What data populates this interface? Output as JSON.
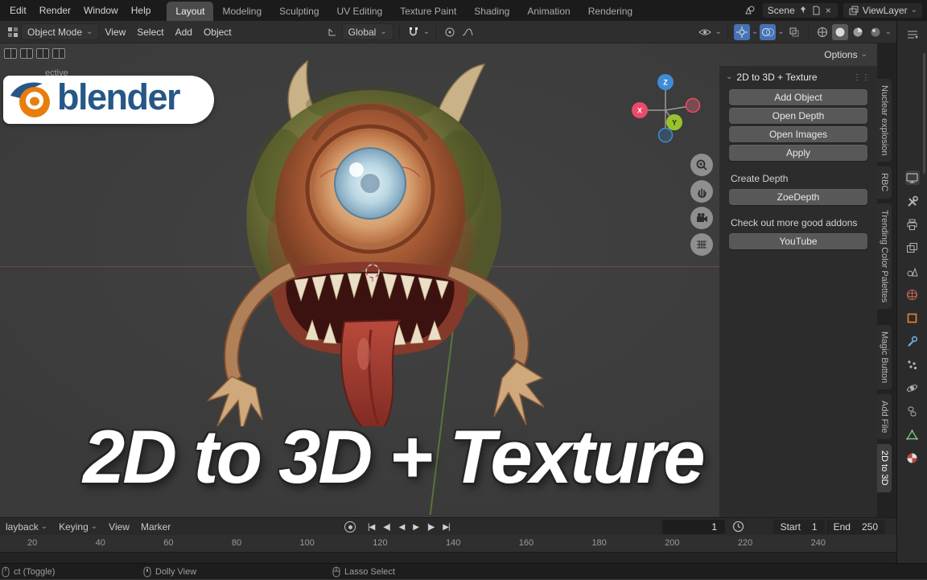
{
  "topbar": {
    "menus": [
      "Edit",
      "Render",
      "Window",
      "Help"
    ],
    "workspaces": [
      "Layout",
      "Modeling",
      "Sculpting",
      "UV Editing",
      "Texture Paint",
      "Shading",
      "Animation",
      "Rendering"
    ],
    "active_workspace": "Layout",
    "scene_label": "Scene",
    "viewlayer_label": "ViewLayer"
  },
  "toolbar": {
    "mode": "Object Mode",
    "menus": [
      "View",
      "Select",
      "Add",
      "Object"
    ],
    "orientation": "Global",
    "options_label": "Options"
  },
  "viewport": {
    "info": "ective",
    "logo_text": "blender",
    "caption": "2D to 3D + Texture",
    "gizmo": {
      "x": "X",
      "y": "Y",
      "z": "Z"
    }
  },
  "side_panel": {
    "title": "2D to 3D + Texture",
    "buttons": [
      "Add Object",
      "Open Depth",
      "Open Images",
      "Apply"
    ],
    "create_depth_label": "Create Depth",
    "zoedepth_button": "ZoeDepth",
    "addons_label": "Check out more good addons",
    "youtube_button": "YouTube"
  },
  "right_tabs": [
    "Nuclear explosion",
    "RBC",
    "Trending Color Palettes",
    "Magic Button",
    "Add File",
    "2D to 3D"
  ],
  "property_tab_icons": [
    "editor-type",
    "tool",
    "render",
    "output",
    "view-layer",
    "scene",
    "world",
    "object",
    "modifiers",
    "particles",
    "physics",
    "data",
    "material"
  ],
  "timeline": {
    "menus": [
      "layback",
      "Keying",
      "View",
      "Marker"
    ],
    "transport": [
      "|◀",
      "◀|",
      "◀",
      "▶",
      "|▶",
      "▶|"
    ],
    "record_glyph": "●",
    "current_frame": "1",
    "start_label": "Start",
    "start_value": "1",
    "end_label": "End",
    "end_value": "250",
    "ruler": [
      "20",
      "40",
      "60",
      "80",
      "100",
      "120",
      "140",
      "160",
      "180",
      "200",
      "220",
      "240"
    ]
  },
  "statusbar": {
    "items": [
      "ct (Toggle)",
      "Dolly View",
      "Lasso Select"
    ]
  },
  "colors": {
    "accent": "#4772b3",
    "button": "#585858",
    "panel_bg": "#2b2b2b",
    "viewport_bg": "#3b3b3b",
    "logo_orange": "#e87d0d",
    "logo_blue": "#265787",
    "axis_x": "#ef4968",
    "axis_y": "#9ac22c",
    "axis_z": "#3f8cd6"
  }
}
